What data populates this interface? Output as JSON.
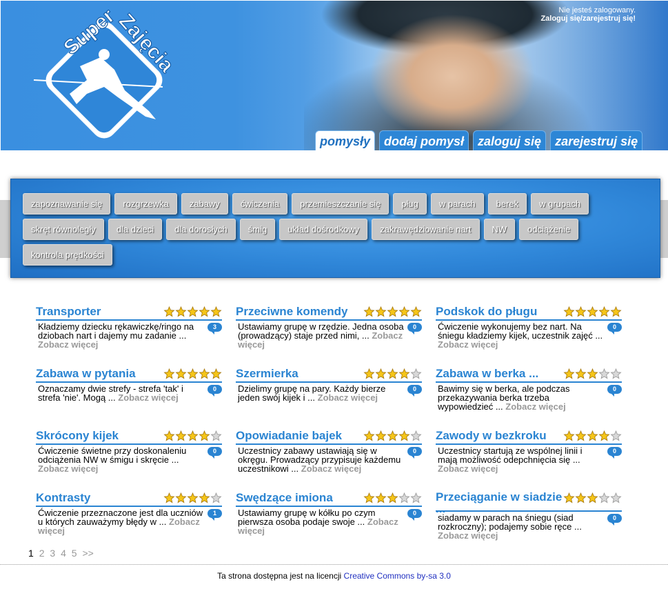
{
  "header": {
    "logo_text": "Super Zajęcia",
    "login_status": "Nie jesteś zalogowany.",
    "login_link": "Zaloguj się/zarejestruj się!"
  },
  "nav": {
    "tabs": [
      {
        "label": "pomysły",
        "active": true
      },
      {
        "label": "dodaj pomysł",
        "active": false
      },
      {
        "label": "zaloguj się",
        "active": false
      },
      {
        "label": "zarejestruj się",
        "active": false
      }
    ]
  },
  "tags": [
    "zapoznawanie się",
    "rozgrzewka",
    "zabawy",
    "ćwiczenia",
    "przemieszczanie się",
    "pług",
    "w parach",
    "berek",
    "w grupach",
    "skręt równoległy",
    "dla dzieci",
    "dla dorosłych",
    "śmig",
    "układ dośrodkowy",
    "zakrawędziowanie nart",
    "NW",
    "odciążenie",
    "kontrola prędkości"
  ],
  "cards": [
    {
      "title": "Transporter",
      "rating": 5,
      "comments": "3",
      "text": "Kładziemy dziecku rękawiczkę/ringo na dziobach nart i dajemy mu zadanie ...",
      "more": "Zobacz więcej"
    },
    {
      "title": "Przeciwne komendy",
      "rating": 5,
      "comments": "0",
      "text": "Ustawiamy grupę w rzędzie. Jedna osoba (prowadzący) staje przed nimi, ...",
      "more": "Zobacz więcej"
    },
    {
      "title": "Podskok do pługu",
      "rating": 5,
      "comments": "0",
      "text": "Ćwiczenie wykonujemy bez nart. Na śniegu kładziemy kijek, uczestnik zajęć ...",
      "more": "Zobacz więcej"
    },
    {
      "title": "Zabawa w pytania",
      "rating": 5,
      "comments": "0",
      "text": "Oznaczamy dwie strefy - strefa 'tak' i strefa 'nie'. Mogą ...",
      "more": "Zobacz więcej"
    },
    {
      "title": "Szermierka",
      "rating": 4,
      "comments": "0",
      "text": "Dzielimy grupę na pary. Każdy bierze jeden swój kijek i ...",
      "more": "Zobacz więcej"
    },
    {
      "title": "Zabawa w berka ...",
      "rating": 3,
      "comments": "0",
      "text": "Bawimy się w berka, ale podczas przekazywania berka trzeba wypowiedzieć ...",
      "more": "Zobacz więcej"
    },
    {
      "title": "Skrócony kijek",
      "rating": 4,
      "comments": "0",
      "text": "Ćwiczenie świetne przy doskonaleniu odciążenia NW w śmigu i skręcie ...",
      "more": "Zobacz więcej"
    },
    {
      "title": "Opowiadanie bajek",
      "rating": 4,
      "comments": "0",
      "text": "Uczestnicy zabawy ustawiają się w okręgu. Prowadzący przypisuje każdemu uczestnikowi ...",
      "more": "Zobacz więcej"
    },
    {
      "title": "Zawody w bezkroku",
      "rating": 4,
      "comments": "0",
      "text": "Uczestnicy startują ze wspólnej linii i mają możliwość odepchnięcia się ...",
      "more": "Zobacz więcej"
    },
    {
      "title": "Kontrasty",
      "rating": 4,
      "comments": "1",
      "text": "Ćwiczenie przeznaczone jest dla uczniów u których zauważymy błędy w ...",
      "more": "Zobacz więcej"
    },
    {
      "title": "Swędzące imiona",
      "rating": 3,
      "comments": "0",
      "text": "Ustawiamy grupę w kółku po czym pierwsza osoba podaje swoje ...",
      "more": "Zobacz więcej"
    },
    {
      "title": "Przeciąganie w siadzie ...",
      "rating": 3,
      "comments": "0",
      "text": "siadamy w parach na śniegu (siad rozkroczny); podajemy sobie ręce ...",
      "more": "Zobacz więcej"
    }
  ],
  "pager": {
    "pages": [
      "1",
      "2",
      "3",
      "4",
      "5",
      ">>"
    ],
    "current": "1"
  },
  "footer": {
    "text": "Ta strona dostępna jest na licencji",
    "link": "Creative Commons by-sa 3.0"
  }
}
